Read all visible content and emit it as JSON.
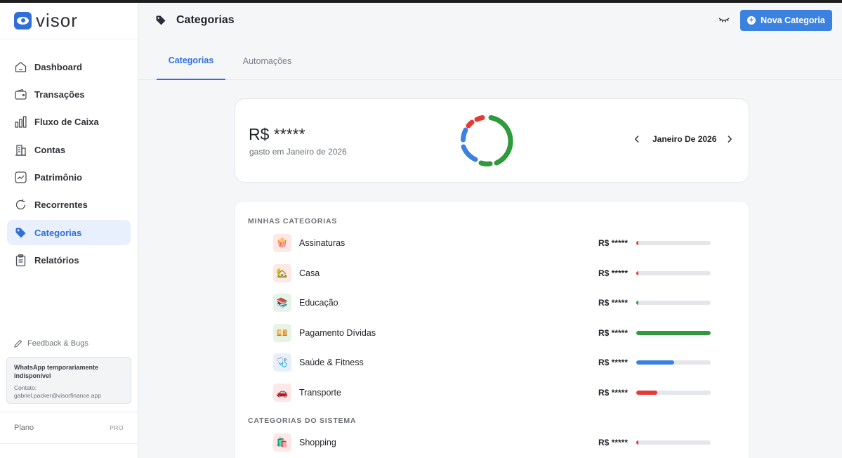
{
  "brand": {
    "name": "visor"
  },
  "sidebar": {
    "items": [
      {
        "label": "Dashboard",
        "icon": "home-icon"
      },
      {
        "label": "Transações",
        "icon": "wallet-icon"
      },
      {
        "label": "Fluxo de Caixa",
        "icon": "bar-chart-icon"
      },
      {
        "label": "Contas",
        "icon": "building-icon"
      },
      {
        "label": "Patrimônio",
        "icon": "trend-icon"
      },
      {
        "label": "Recorrentes",
        "icon": "refresh-icon"
      },
      {
        "label": "Categorias",
        "icon": "tag-icon",
        "active": true
      },
      {
        "label": "Relatórios",
        "icon": "clipboard-icon"
      }
    ],
    "feedback": "Feedback & Bugs",
    "whatsapp": {
      "title": "WhatsApp temporariamente indisponível",
      "contact": "Contato: gabriel.packer@visorfinance.app"
    },
    "plan": {
      "label": "Plano",
      "badge": "PRO"
    }
  },
  "header": {
    "title": "Categorias",
    "new_button": "Nova Categoria"
  },
  "tabs": [
    {
      "label": "Categorias",
      "active": true
    },
    {
      "label": "Automações"
    }
  ],
  "summary": {
    "amount": "R$ *****",
    "subtitle": "gasto em Janeiro de 2026",
    "month": "Janeiro De 2026",
    "donut_colors": [
      "#2e9a3c",
      "#3b82e0",
      "#e53935"
    ]
  },
  "categories": {
    "mine_title": "MINHAS CATEGORIAS",
    "system_title": "CATEGORIAS DO SISTEMA",
    "mine": [
      {
        "name": "Assinaturas",
        "emoji": "🍿",
        "amount": "R$ *****",
        "progress": 0.02,
        "color": "#e53935",
        "bg": "#fde8e6"
      },
      {
        "name": "Casa",
        "emoji": "🏡",
        "amount": "R$ *****",
        "progress": 0.02,
        "color": "#e53935",
        "bg": "#fde8e6"
      },
      {
        "name": "Educação",
        "emoji": "📚",
        "amount": "R$ *****",
        "progress": 0.03,
        "color": "#2e9a3c",
        "bg": "#e6f4e8"
      },
      {
        "name": "Pagamento Dívidas",
        "emoji": "💴",
        "amount": "R$ *****",
        "progress": 1.0,
        "color": "#2e9a3c",
        "bg": "#e6f4e8"
      },
      {
        "name": "Saúde & Fitness",
        "emoji": "🩺",
        "amount": "R$ *****",
        "progress": 0.51,
        "color": "#3b82e0",
        "bg": "#e6effb"
      },
      {
        "name": "Transporte",
        "emoji": "🚗",
        "amount": "R$ *****",
        "progress": 0.28,
        "color": "#e53935",
        "bg": "#fde8e6"
      }
    ],
    "system": [
      {
        "name": "Shopping",
        "emoji": "🛍️",
        "amount": "R$ *****",
        "progress": 0.02,
        "color": "#e53935",
        "bg": "#fde8e6"
      }
    ]
  }
}
